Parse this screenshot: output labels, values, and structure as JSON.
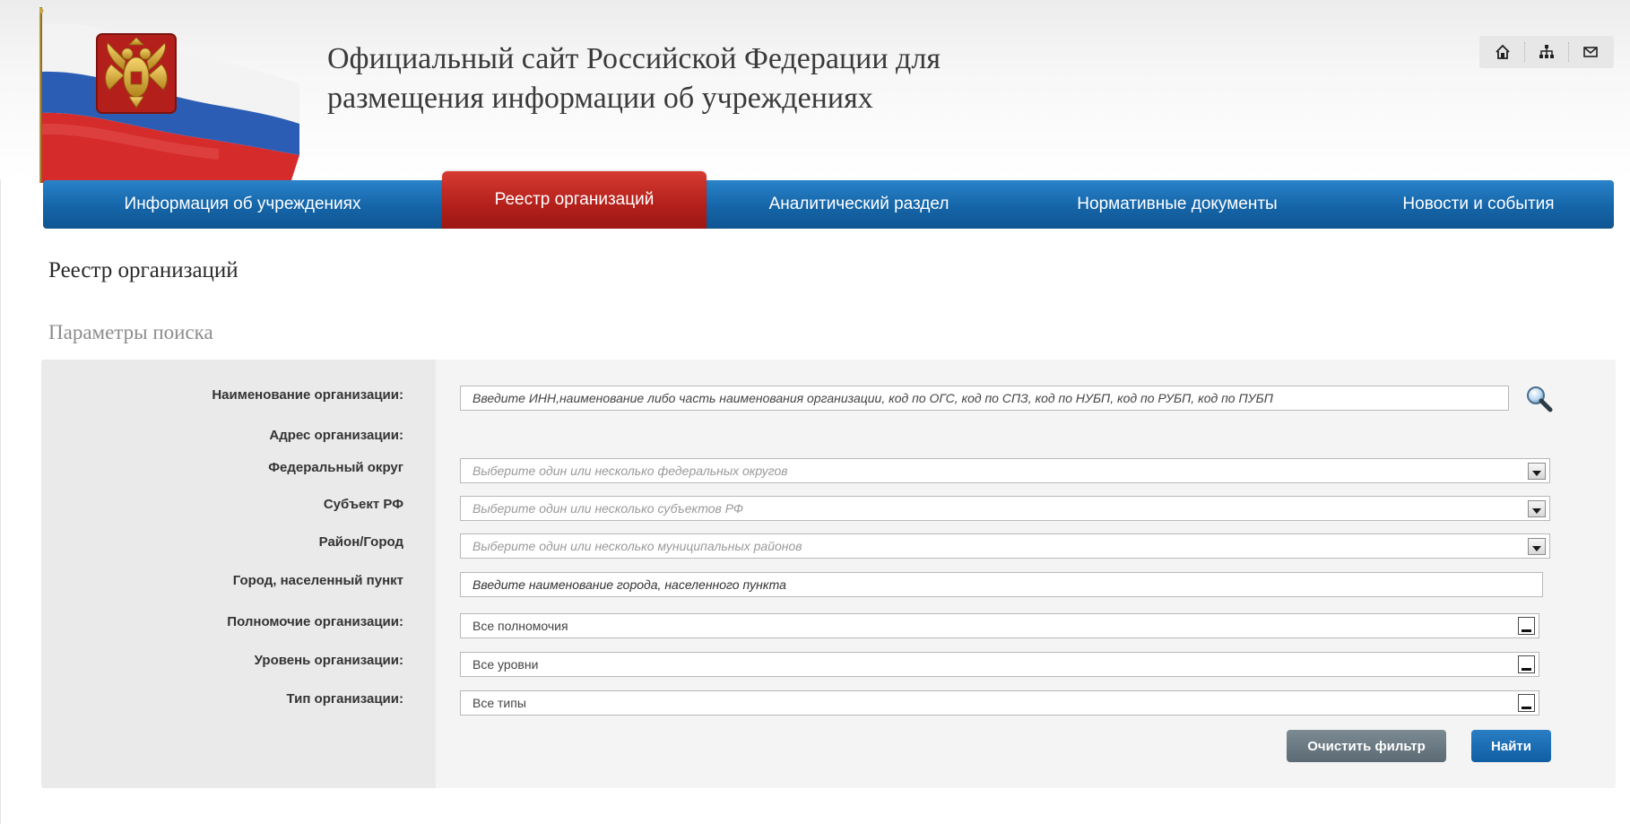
{
  "header": {
    "title_line1": "Официальный сайт Российской Федерации для",
    "title_line2": "размещения информации об учреждениях",
    "icons": [
      "home-icon",
      "sitemap-icon",
      "mail-icon"
    ]
  },
  "nav": {
    "items": [
      {
        "label": "Информация об учреждениях"
      },
      {
        "label": "Реестр организаций",
        "active": true
      },
      {
        "label": "Аналитический раздел"
      },
      {
        "label": "Нормативные документы"
      },
      {
        "label": "Новости и события"
      }
    ]
  },
  "page": {
    "title": "Реестр организаций",
    "section_title": "Параметры поиска"
  },
  "form": {
    "org_name_label": "Наименование организации:",
    "org_name_placeholder": "Введите ИНН,наименование либо часть наименования организации, код по ОГС, код по СПЗ, код по НУБП, код по РУБП, код по ПУБП",
    "address_label": "Адрес организации:",
    "fed_district_label": "Федеральный округ",
    "fed_district_placeholder": "Выберите один или несколько федеральных округов",
    "subject_label": "Субъект РФ",
    "subject_placeholder": "Выберите один или несколько субъектов РФ",
    "district_label": "Район/Город",
    "district_placeholder": "Выберите один или несколько муниципальных районов",
    "city_label": "Город, населенный пункт",
    "city_placeholder": "Введите наименование города, населенного пункта",
    "authority_label": "Полномочие организации:",
    "authority_value": "Все полномочия",
    "level_label": "Уровень организации:",
    "level_value": "Все уровни",
    "type_label": "Тип организации:",
    "type_value": "Все типы",
    "clear_button": "Очистить фильтр",
    "find_button": "Найти"
  },
  "colors": {
    "nav_blue": "#1565a8",
    "nav_active_red": "#b3201b",
    "btn_find": "#0f5ea4",
    "btn_clear": "#5b6a74"
  }
}
